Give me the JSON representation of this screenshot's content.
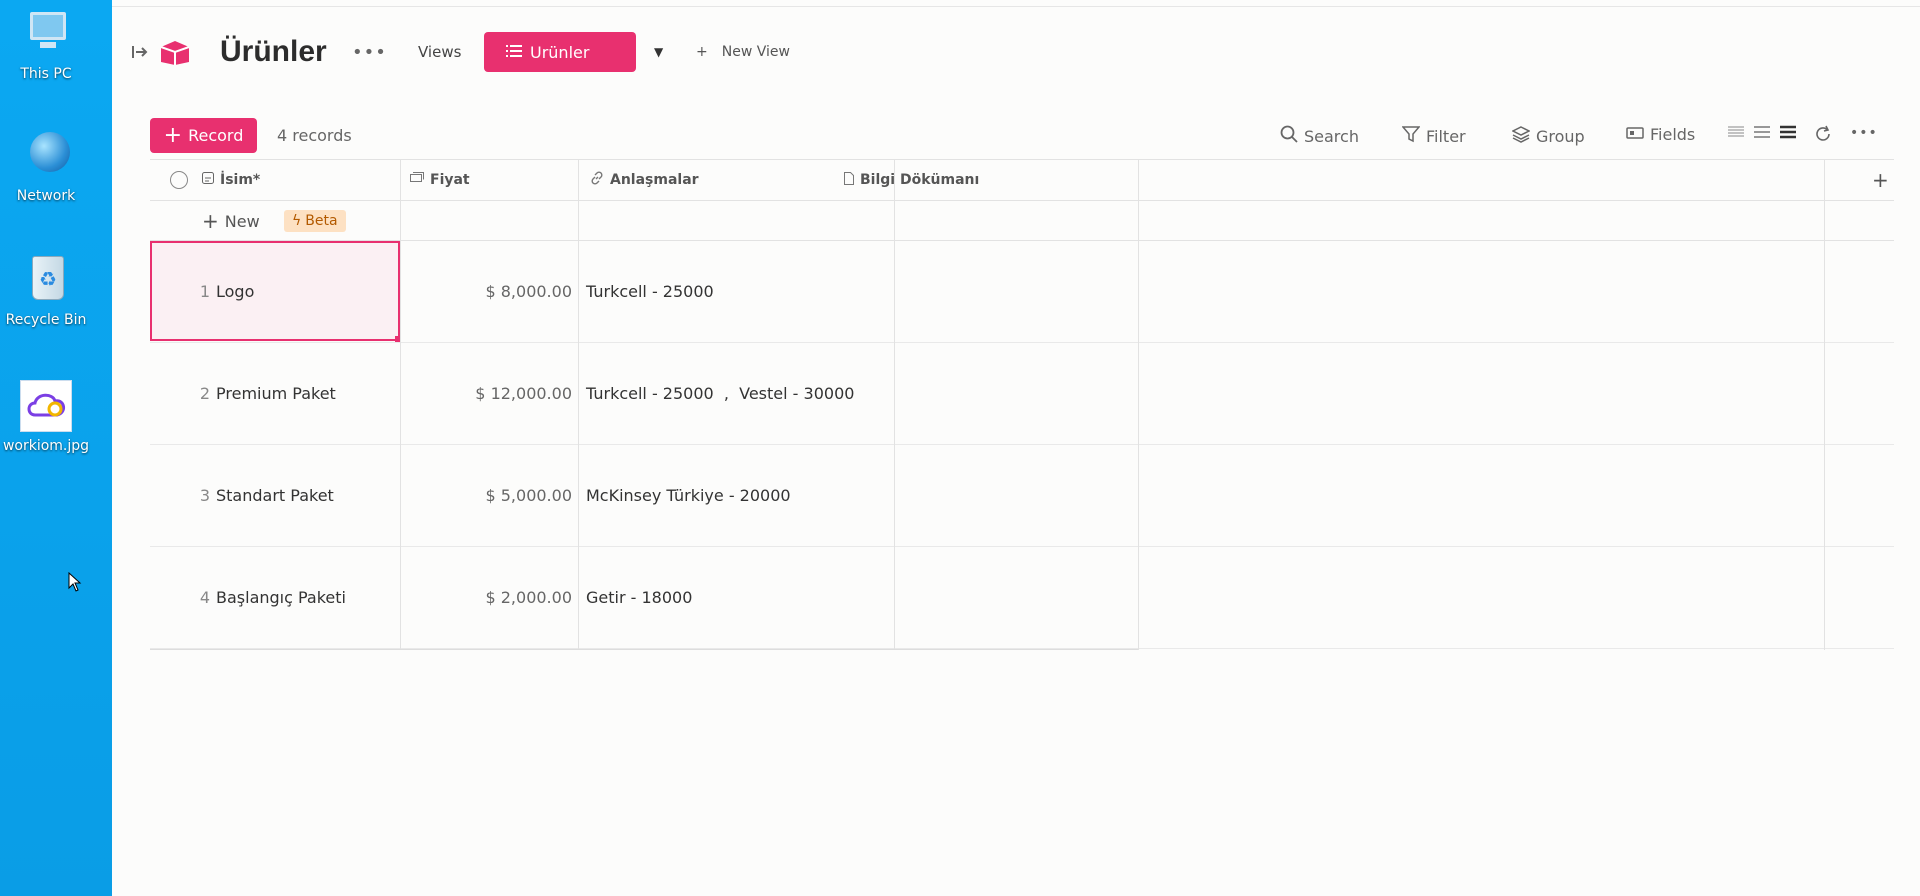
{
  "desktop": {
    "icons": [
      {
        "label": "This PC",
        "icon": "computer-icon"
      },
      {
        "label": "Network",
        "icon": "network-icon"
      },
      {
        "label": "Recycle Bin",
        "icon": "recycle-bin-icon"
      },
      {
        "label": "workiom.jpg",
        "icon": "image-file-icon"
      }
    ]
  },
  "header": {
    "title": "Ürünler",
    "views_label": "Views",
    "active_view": "Urünler",
    "new_view": "New View"
  },
  "toolbar": {
    "record_label": "Record",
    "record_count": "4 records",
    "search": "Search",
    "filter": "Filter",
    "group": "Group",
    "fields": "Fields"
  },
  "table": {
    "columns": [
      "İsim*",
      "Fiyat",
      "Anlaşmalar",
      "Bilgi Dökümanı"
    ],
    "new_row_label": "New",
    "beta_label": "Beta",
    "rows": [
      {
        "num": "1",
        "name": "Logo",
        "price": "$ 8,000.00",
        "deals": "Turkcell - 25000"
      },
      {
        "num": "2",
        "name": "Premium Paket",
        "price": "$ 12,000.00",
        "deals": "Turkcell - 25000  ,  Vestel - 30000"
      },
      {
        "num": "3",
        "name": "Standart Paket",
        "price": "$ 5,000.00",
        "deals": "McKinsey Türkiye - 20000"
      },
      {
        "num": "4",
        "name": "Başlangıç Paketi",
        "price": "$ 2,000.00",
        "deals": "Getir - 18000"
      }
    ]
  },
  "colors": {
    "accent": "#e8306f",
    "desktop": "#0aa5ee"
  }
}
